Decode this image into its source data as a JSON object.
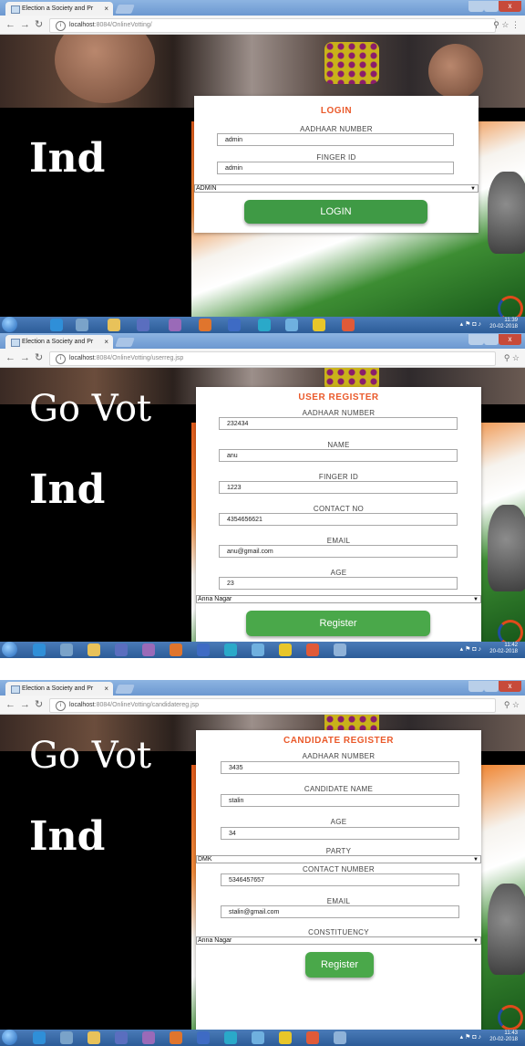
{
  "browser": {
    "tab_title": "Election a Society and Pr",
    "tab_close": "×",
    "url_host": "localhost",
    "close_glyph": "x",
    "icons": [
      "back-arrow-icon",
      "forward-arrow-icon",
      "reload-icon",
      "info-icon",
      "zoom-icon",
      "star-icon"
    ]
  },
  "screens": [
    {
      "url_path": ":8084/OnlineVotting/",
      "bg_text": "Ind",
      "title": "LOGIN",
      "fields": [
        {
          "label": "AADHAAR NUMBER",
          "value": "admin"
        },
        {
          "label": "FINGER ID",
          "value": "admin"
        }
      ],
      "select": "ADMIN",
      "button": "LOGIN",
      "clock": {
        "time": "11:39",
        "date": "20-02-2018"
      }
    },
    {
      "url_path": ":8084/OnlineVotting/userreg.jsp",
      "bg_text_top": "Go Vot",
      "bg_text": "Ind",
      "title": "USER REGISTER",
      "fields": [
        {
          "label": "AADHAAR NUMBER",
          "value": "232434"
        },
        {
          "label": "NAME",
          "value": "anu"
        },
        {
          "label": "FINGER ID",
          "value": "1223"
        },
        {
          "label": "CONTACT NO",
          "value": "4354656621"
        },
        {
          "label": "EMAIL",
          "value": "anu@gmail.com"
        },
        {
          "label": "AGE",
          "value": "23"
        }
      ],
      "select": "Anna Nagar",
      "button": "Register",
      "clock": {
        "time": "11:42",
        "date": "20-02-2018"
      }
    },
    {
      "url_path": ":8084/OnlineVotting/candidatereg.jsp",
      "bg_text_top": "Go Vot",
      "bg_text": "Ind",
      "title": "CANDIDATE REGISTER",
      "fields": [
        {
          "label": "AADHAAR NUMBER",
          "value": "3435"
        },
        {
          "label": "CANDIDATE NAME",
          "value": "stalin"
        },
        {
          "label": "AGE",
          "value": "34"
        },
        {
          "label": "PARTY",
          "select": "DMK"
        },
        {
          "label": "CONTACT NUMBER",
          "value": "5346457657"
        },
        {
          "label": "EMAIL",
          "value": "stalin@gmail.com"
        },
        {
          "label": "CONSTITUENCY",
          "select": "Anna Nagar"
        }
      ],
      "button": "Register",
      "clock": {
        "time": "11:43",
        "date": "20-02-2018"
      }
    }
  ],
  "colors": {
    "title_orange": "#ea5a2b",
    "button_green": "#4aa84a",
    "taskbar_blue": "#2c5c98",
    "flag_saffron": "#e05a1a",
    "flag_green": "#3d8d33"
  }
}
